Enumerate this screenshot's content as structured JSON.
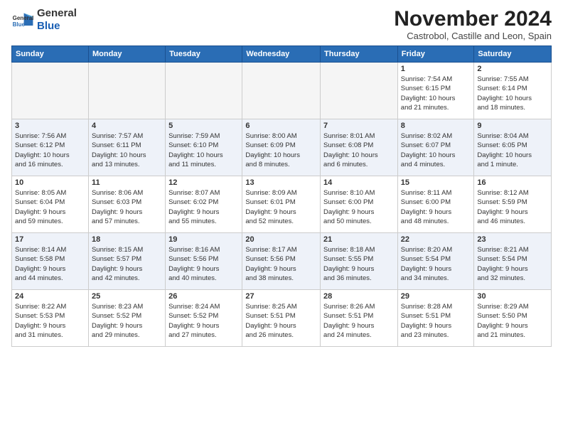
{
  "header": {
    "logo_general": "General",
    "logo_blue": "Blue",
    "month_title": "November 2024",
    "subtitle": "Castrobol, Castille and Leon, Spain"
  },
  "weekdays": [
    "Sunday",
    "Monday",
    "Tuesday",
    "Wednesday",
    "Thursday",
    "Friday",
    "Saturday"
  ],
  "weeks": [
    [
      {
        "day": "",
        "info": ""
      },
      {
        "day": "",
        "info": ""
      },
      {
        "day": "",
        "info": ""
      },
      {
        "day": "",
        "info": ""
      },
      {
        "day": "",
        "info": ""
      },
      {
        "day": "1",
        "info": "Sunrise: 7:54 AM\nSunset: 6:15 PM\nDaylight: 10 hours\nand 21 minutes."
      },
      {
        "day": "2",
        "info": "Sunrise: 7:55 AM\nSunset: 6:14 PM\nDaylight: 10 hours\nand 18 minutes."
      }
    ],
    [
      {
        "day": "3",
        "info": "Sunrise: 7:56 AM\nSunset: 6:12 PM\nDaylight: 10 hours\nand 16 minutes."
      },
      {
        "day": "4",
        "info": "Sunrise: 7:57 AM\nSunset: 6:11 PM\nDaylight: 10 hours\nand 13 minutes."
      },
      {
        "day": "5",
        "info": "Sunrise: 7:59 AM\nSunset: 6:10 PM\nDaylight: 10 hours\nand 11 minutes."
      },
      {
        "day": "6",
        "info": "Sunrise: 8:00 AM\nSunset: 6:09 PM\nDaylight: 10 hours\nand 8 minutes."
      },
      {
        "day": "7",
        "info": "Sunrise: 8:01 AM\nSunset: 6:08 PM\nDaylight: 10 hours\nand 6 minutes."
      },
      {
        "day": "8",
        "info": "Sunrise: 8:02 AM\nSunset: 6:07 PM\nDaylight: 10 hours\nand 4 minutes."
      },
      {
        "day": "9",
        "info": "Sunrise: 8:04 AM\nSunset: 6:05 PM\nDaylight: 10 hours\nand 1 minute."
      }
    ],
    [
      {
        "day": "10",
        "info": "Sunrise: 8:05 AM\nSunset: 6:04 PM\nDaylight: 9 hours\nand 59 minutes."
      },
      {
        "day": "11",
        "info": "Sunrise: 8:06 AM\nSunset: 6:03 PM\nDaylight: 9 hours\nand 57 minutes."
      },
      {
        "day": "12",
        "info": "Sunrise: 8:07 AM\nSunset: 6:02 PM\nDaylight: 9 hours\nand 55 minutes."
      },
      {
        "day": "13",
        "info": "Sunrise: 8:09 AM\nSunset: 6:01 PM\nDaylight: 9 hours\nand 52 minutes."
      },
      {
        "day": "14",
        "info": "Sunrise: 8:10 AM\nSunset: 6:00 PM\nDaylight: 9 hours\nand 50 minutes."
      },
      {
        "day": "15",
        "info": "Sunrise: 8:11 AM\nSunset: 6:00 PM\nDaylight: 9 hours\nand 48 minutes."
      },
      {
        "day": "16",
        "info": "Sunrise: 8:12 AM\nSunset: 5:59 PM\nDaylight: 9 hours\nand 46 minutes."
      }
    ],
    [
      {
        "day": "17",
        "info": "Sunrise: 8:14 AM\nSunset: 5:58 PM\nDaylight: 9 hours\nand 44 minutes."
      },
      {
        "day": "18",
        "info": "Sunrise: 8:15 AM\nSunset: 5:57 PM\nDaylight: 9 hours\nand 42 minutes."
      },
      {
        "day": "19",
        "info": "Sunrise: 8:16 AM\nSunset: 5:56 PM\nDaylight: 9 hours\nand 40 minutes."
      },
      {
        "day": "20",
        "info": "Sunrise: 8:17 AM\nSunset: 5:56 PM\nDaylight: 9 hours\nand 38 minutes."
      },
      {
        "day": "21",
        "info": "Sunrise: 8:18 AM\nSunset: 5:55 PM\nDaylight: 9 hours\nand 36 minutes."
      },
      {
        "day": "22",
        "info": "Sunrise: 8:20 AM\nSunset: 5:54 PM\nDaylight: 9 hours\nand 34 minutes."
      },
      {
        "day": "23",
        "info": "Sunrise: 8:21 AM\nSunset: 5:54 PM\nDaylight: 9 hours\nand 32 minutes."
      }
    ],
    [
      {
        "day": "24",
        "info": "Sunrise: 8:22 AM\nSunset: 5:53 PM\nDaylight: 9 hours\nand 31 minutes."
      },
      {
        "day": "25",
        "info": "Sunrise: 8:23 AM\nSunset: 5:52 PM\nDaylight: 9 hours\nand 29 minutes."
      },
      {
        "day": "26",
        "info": "Sunrise: 8:24 AM\nSunset: 5:52 PM\nDaylight: 9 hours\nand 27 minutes."
      },
      {
        "day": "27",
        "info": "Sunrise: 8:25 AM\nSunset: 5:51 PM\nDaylight: 9 hours\nand 26 minutes."
      },
      {
        "day": "28",
        "info": "Sunrise: 8:26 AM\nSunset: 5:51 PM\nDaylight: 9 hours\nand 24 minutes."
      },
      {
        "day": "29",
        "info": "Sunrise: 8:28 AM\nSunset: 5:51 PM\nDaylight: 9 hours\nand 23 minutes."
      },
      {
        "day": "30",
        "info": "Sunrise: 8:29 AM\nSunset: 5:50 PM\nDaylight: 9 hours\nand 21 minutes."
      }
    ]
  ]
}
